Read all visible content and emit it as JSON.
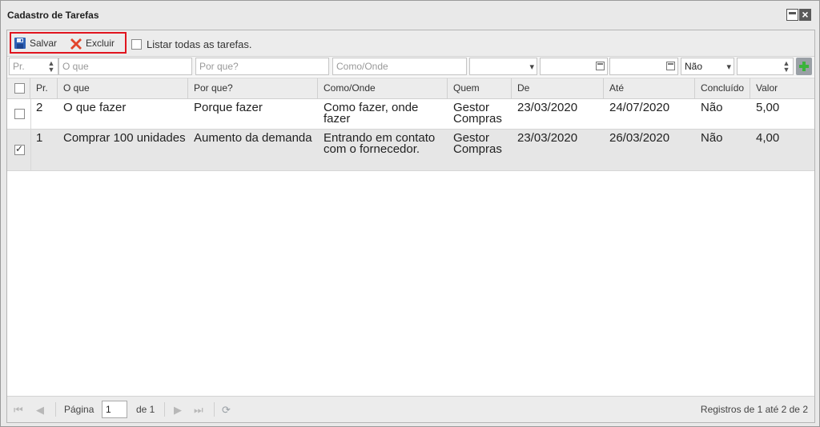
{
  "window": {
    "title": "Cadastro de Tarefas"
  },
  "toolbar": {
    "save_label": "Salvar",
    "delete_label": "Excluir",
    "list_all_label": "Listar todas as tarefas."
  },
  "filters": {
    "pr_placeholder": "Pr.",
    "oque_placeholder": "O que",
    "porque_placeholder": "Por que?",
    "comoonde_placeholder": "Como/Onde",
    "concluido_value": "Não"
  },
  "columns": [
    "Pr.",
    "O que",
    "Por que?",
    "Como/Onde",
    "Quem",
    "De",
    "Até",
    "Concluído",
    "Valor"
  ],
  "rows": [
    {
      "pr": "2",
      "oque": "O que fazer",
      "porque": "Porque fazer",
      "comoonde": "Como fazer, onde fazer",
      "quem": "Gestor Compras",
      "de": "23/03/2020",
      "ate": "24/07/2020",
      "concluido": "Não",
      "valor": "5,00",
      "checked": false
    },
    {
      "pr": "1",
      "oque": "Comprar 100 unidades",
      "porque": "Aumento da demanda",
      "comoonde": "Entrando em contato com o fornecedor.",
      "quem": "Gestor Compras",
      "de": "23/03/2020",
      "ate": "26/03/2020",
      "concluido": "Não",
      "valor": "4,00",
      "checked": true
    }
  ],
  "pager": {
    "page_label": "Página",
    "page_value": "1",
    "of_label": "de 1",
    "info": "Registros de 1 até 2 de 2"
  },
  "icons": {
    "save": "floppy-disk-icon",
    "delete": "red-x-icon",
    "add_filter": "green-plus-icon"
  },
  "colors": {
    "highlight": "#e0141e",
    "add_green": "#3bb33b"
  }
}
